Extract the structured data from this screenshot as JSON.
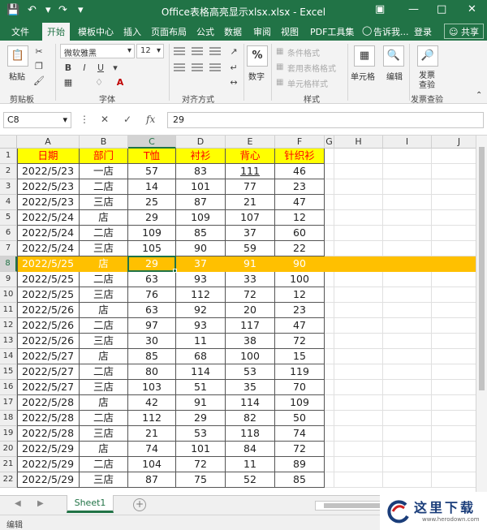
{
  "window": {
    "title": "Office表格高亮显示xlsx.xlsx - Excel",
    "title_bg": "#217346"
  },
  "ribbon": {
    "tabs": [
      "文件",
      "开始",
      "模板中心",
      "插入",
      "页面布局",
      "公式",
      "数据",
      "审阅",
      "视图",
      "PDF工具集"
    ],
    "active_tab": "开始",
    "tell_me": "告诉我...",
    "login": "登录",
    "share": "共享",
    "font_name": "微软雅黑",
    "font_size": "12",
    "paste_label": "粘贴",
    "clipboard_label": "剪贴板",
    "font_group_label": "字体",
    "align_group_label": "对齐方式",
    "number_label": "数字",
    "number_btn": "%",
    "cond_format": "条件格式",
    "table_format": "套用表格格式",
    "cell_style": "单元格样式",
    "style_label": "样式",
    "cells_label": "单元格",
    "edit_label": "编辑",
    "send_label": "发票\n查验",
    "send_label_1": "发票",
    "send_label_2": "查验",
    "invoice_group_label": "发票查验",
    "bold": "B",
    "italic": "I",
    "underline": "U"
  },
  "formula_bar": {
    "name_box": "C8",
    "value": "29",
    "fx": "fx"
  },
  "columns": [
    "A",
    "B",
    "C",
    "D",
    "E",
    "F",
    "G",
    "H",
    "I",
    "J"
  ],
  "header_row": [
    "日期",
    "部门",
    "T恤",
    "衬衫",
    "背心",
    "针织衫"
  ],
  "rows": [
    [
      "2022/5/23",
      "一店",
      "57",
      "83",
      "111",
      "46"
    ],
    [
      "2022/5/23",
      "二店",
      "14",
      "101",
      "77",
      "23"
    ],
    [
      "2022/5/23",
      "三店",
      "25",
      "87",
      "21",
      "47"
    ],
    [
      "2022/5/24",
      "店",
      "29",
      "109",
      "107",
      "12"
    ],
    [
      "2022/5/24",
      "二店",
      "109",
      "85",
      "37",
      "60"
    ],
    [
      "2022/5/24",
      "三店",
      "105",
      "90",
      "59",
      "22"
    ],
    [
      "2022/5/25",
      "店",
      "29",
      "37",
      "91",
      "90"
    ],
    [
      "2022/5/25",
      "二店",
      "63",
      "93",
      "33",
      "100"
    ],
    [
      "2022/5/25",
      "三店",
      "76",
      "112",
      "72",
      "12"
    ],
    [
      "2022/5/26",
      "店",
      "63",
      "92",
      "20",
      "23"
    ],
    [
      "2022/5/26",
      "二店",
      "97",
      "93",
      "117",
      "47"
    ],
    [
      "2022/5/26",
      "三店",
      "30",
      "11",
      "38",
      "72"
    ],
    [
      "2022/5/27",
      "店",
      "85",
      "68",
      "100",
      "15"
    ],
    [
      "2022/5/27",
      "二店",
      "80",
      "114",
      "53",
      "119"
    ],
    [
      "2022/5/27",
      "三店",
      "103",
      "51",
      "35",
      "70"
    ],
    [
      "2022/5/28",
      "店",
      "42",
      "91",
      "114",
      "109"
    ],
    [
      "2022/5/28",
      "二店",
      "112",
      "29",
      "82",
      "50"
    ],
    [
      "2022/5/28",
      "三店",
      "21",
      "53",
      "118",
      "74"
    ],
    [
      "2022/5/29",
      "店",
      "74",
      "101",
      "84",
      "72"
    ],
    [
      "2022/5/29",
      "二店",
      "104",
      "72",
      "11",
      "89"
    ],
    [
      "2022/5/29",
      "三店",
      "87",
      "75",
      "52",
      "85"
    ]
  ],
  "row_numbers": [
    "1",
    "2",
    "3",
    "4",
    "5",
    "6",
    "7",
    "8",
    "9",
    "10",
    "11",
    "12",
    "13",
    "14",
    "15",
    "16",
    "17",
    "18",
    "19",
    "20",
    "21",
    "22"
  ],
  "highlight_row": 8,
  "active_cell": "C8",
  "colors": {
    "header_fill": "#ffff00",
    "header_text": "#ff0000",
    "highlight_fill": "#ffc000",
    "highlight_text": "#ffffff",
    "accent": "#217346"
  },
  "sheet_tabs": [
    "Sheet1"
  ],
  "status": "编辑",
  "watermark": {
    "cn": "这里下载",
    "url": "www.herodown.com"
  }
}
